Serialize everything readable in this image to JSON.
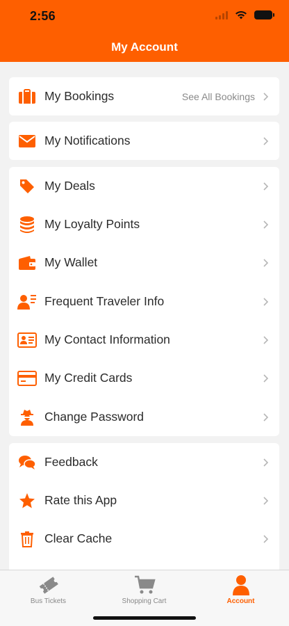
{
  "status_bar": {
    "time": "2:56"
  },
  "header": {
    "title": "My Account"
  },
  "colors": {
    "accent": "#fe5f00",
    "background": "#f2f2f2",
    "card": "#ffffff",
    "text": "#2b2b2b",
    "muted": "#8a8a8a"
  },
  "sections": [
    {
      "items": [
        {
          "label": "My Bookings",
          "icon": "briefcase-icon",
          "hint": "See All Bookings"
        }
      ]
    },
    {
      "items": [
        {
          "label": "My Notifications",
          "icon": "envelope-icon"
        }
      ]
    },
    {
      "items": [
        {
          "label": "My Deals",
          "icon": "tag-icon"
        },
        {
          "label": "My Loyalty Points",
          "icon": "coin-stack-icon"
        },
        {
          "label": "My Wallet",
          "icon": "wallet-icon"
        },
        {
          "label": "Frequent Traveler Info",
          "icon": "user-list-icon"
        },
        {
          "label": "My Contact Information",
          "icon": "id-card-icon"
        },
        {
          "label": "My Credit Cards",
          "icon": "credit-card-icon"
        },
        {
          "label": "Change Password",
          "icon": "user-secret-icon"
        }
      ]
    },
    {
      "items": [
        {
          "label": "Feedback",
          "icon": "chat-bubbles-icon"
        },
        {
          "label": "Rate this App",
          "icon": "star-icon"
        },
        {
          "label": "Clear Cache",
          "icon": "trash-icon"
        }
      ]
    }
  ],
  "tabbar": {
    "tabs": [
      {
        "label": "Bus Tickets",
        "icon": "ticket-icon",
        "active": false
      },
      {
        "label": "Shopping Cart",
        "icon": "shopping-cart-icon",
        "active": false
      },
      {
        "label": "Account",
        "icon": "user-icon",
        "active": true
      }
    ]
  }
}
